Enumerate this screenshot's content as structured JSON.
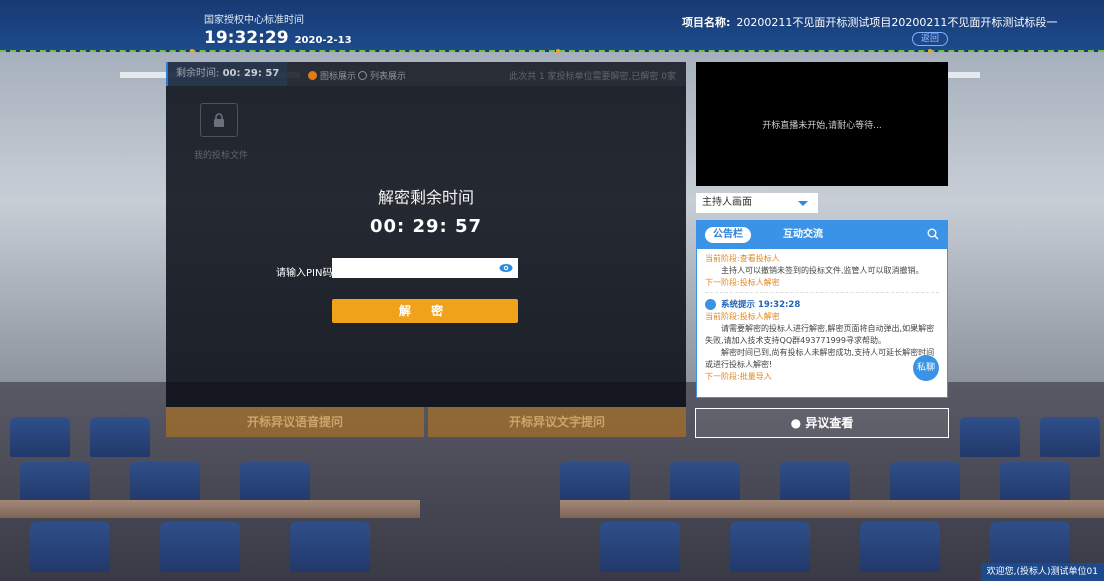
{
  "header": {
    "time_label": "国家授权中心标准时间",
    "time": "19:32:29",
    "date": "2020-2-13",
    "project_label": "项目名称:",
    "project_name": "20200211不见面开标测试项目20200211不见面开标测试标段一",
    "back_label": "返回"
  },
  "panel": {
    "remaining_label": "剩余时间:",
    "remaining_value": "00: 29: 57",
    "view_icon": "图标展示",
    "view_list": "列表展示",
    "stats": "此次共 1 家投标单位需要解密,已解密 0家",
    "folder_label": "我的投标文件",
    "decrypt_title": "解密剩余时间",
    "decrypt_timer": "00: 29: 57",
    "pin_label": "请输入PIN码:",
    "pin_value": "",
    "decrypt_button": "解 密",
    "voice_objection": "开标异议语音提问",
    "text_objection": "开标异议文字提问"
  },
  "video": {
    "status": "开标直播未开始,请耐心等待..."
  },
  "host_select": {
    "selected": "主持人画面"
  },
  "chat": {
    "tab_notice": "公告栏",
    "tab_interact": "互动交流",
    "msg1": {
      "stage": "当前阶段:查看投标人",
      "body": "主持人可以撤销未签到的投标文件,监管人可以取消撤销。",
      "next": "下一阶段:投标人解密"
    },
    "msg2": {
      "title": "系统提示 19:32:28",
      "stage": "当前阶段:投标人解密",
      "body1": "请需要解密的投标人进行解密,解密页面将自动弹出,如果解密失败,请加入技术支持QQ群493771999寻求帮助。",
      "body2": "解密时间已到,尚有投标人未解密成功,支持人可延长解密时间或进行投标人解密!",
      "next": "下一阶段:批量导入"
    },
    "private_label": "私聊"
  },
  "objection_view": "异议查看",
  "welcome": "欢迎您,(投标人)测试单位01",
  "colors": {
    "header_bg": "#1d4a8c",
    "accent_orange": "#f0a21a",
    "accent_blue": "#3a93e6"
  }
}
